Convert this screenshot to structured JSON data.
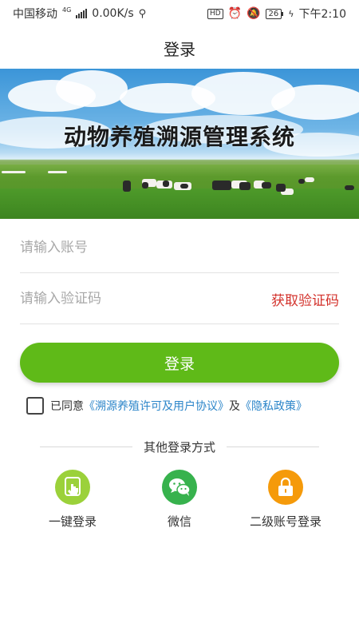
{
  "status_bar": {
    "carrier": "中国移动",
    "network": "4G",
    "speed": "0.00K/s",
    "hd": "HD",
    "battery": "26",
    "time": "下午2:10"
  },
  "nav": {
    "title": "登录"
  },
  "banner": {
    "title": "动物养殖溯源管理系统"
  },
  "form": {
    "account_placeholder": "请输入账号",
    "code_placeholder": "请输入验证码",
    "get_code": "获取验证码",
    "login_button": "登录"
  },
  "agreement": {
    "prefix": "已同意",
    "user_agreement": "《溯源养殖许可及用户协议》",
    "joiner": "及",
    "privacy_policy": "《隐私政策》",
    "checked": false
  },
  "other_login": {
    "title": "其他登录方式",
    "methods": [
      {
        "label": "一键登录",
        "icon": "tap-finger-icon",
        "color": "#9bd13a"
      },
      {
        "label": "微信",
        "icon": "wechat-icon",
        "color": "#37b24d"
      },
      {
        "label": "二级账号登录",
        "icon": "lock-icon",
        "color": "#f59a0a"
      }
    ]
  },
  "colors": {
    "primary_green": "#5fba18",
    "link_blue": "#2b85c9",
    "accent_red": "#d3322c"
  }
}
